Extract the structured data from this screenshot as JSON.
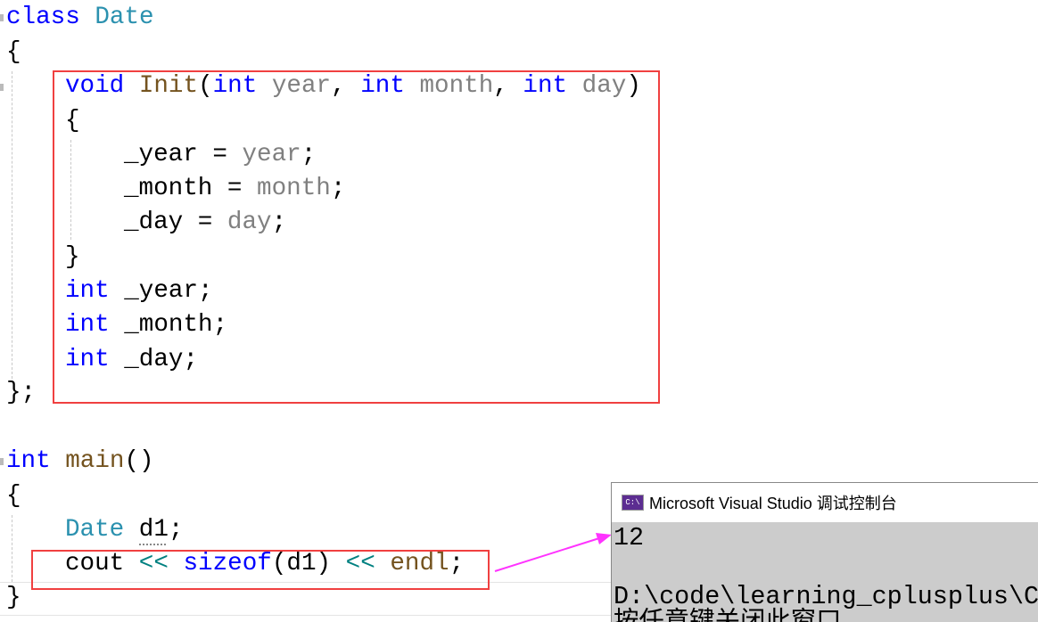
{
  "editor": {
    "lines": [
      {
        "t1": "class",
        "t2": " ",
        "t3": "Date"
      },
      {
        "t1": "{"
      },
      {
        "t1": "void",
        "t2": " ",
        "t3": "Init",
        "t4": "(",
        "t5": "int",
        "t6": " ",
        "t7": "year",
        "t8": ", ",
        "t9": "int",
        "t10": " ",
        "t11": "month",
        "t12": ", ",
        "t13": "int",
        "t14": " ",
        "t15": "day",
        "t16": ")"
      },
      {
        "t1": "{"
      },
      {
        "t1": "_year = ",
        "t2": "year",
        "t3": ";"
      },
      {
        "t1": "_month = ",
        "t2": "month",
        "t3": ";"
      },
      {
        "t1": "_day = ",
        "t2": "day",
        "t3": ";"
      },
      {
        "t1": "}"
      },
      {
        "t1": "int",
        "t2": " _year;"
      },
      {
        "t1": "int",
        "t2": " _month;"
      },
      {
        "t1": "int",
        "t2": " _day;"
      },
      {
        "t1": "};"
      },
      {
        "t1": "int",
        "t2": " ",
        "t3": "main",
        "t4": "()"
      },
      {
        "t1": "{"
      },
      {
        "t1": "Date",
        "t2": " d1;"
      },
      {
        "t1": "cout ",
        "t2": "<<",
        "t3": " ",
        "t4": "sizeof",
        "t5": "(d1) ",
        "t6": "<<",
        "t7": " ",
        "t8": "endl",
        "t9": ";"
      },
      {
        "t1": "}"
      }
    ]
  },
  "console": {
    "icon_label": "C:\\",
    "title": "Microsoft Visual Studio 调试控制台",
    "output": [
      "12",
      "",
      "D:\\code\\learning_cplusplus\\C",
      "按任意键关闭此窗口"
    ]
  },
  "colors": {
    "keyword": "#0000ff",
    "type": "#2b91af",
    "function": "#74531f",
    "parameter": "#808080",
    "operator": "#008080",
    "highlight_box": "#f04040",
    "arrow": "#ff33ff",
    "console_bg": "#cccccc"
  }
}
